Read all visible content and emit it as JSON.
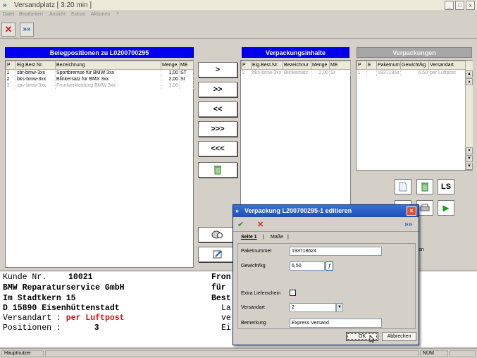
{
  "window": {
    "title": "Versandplatz  [ 3:20 min ]",
    "minimize": "_",
    "maximize": "□",
    "close": "x"
  },
  "menu": [
    "Datei",
    "Bearbeiten",
    "Ansicht",
    "Extras",
    "Aktionen",
    "?"
  ],
  "toolbar": {
    "close_glyph": "✕",
    "forward_glyph": "»»"
  },
  "belegpositionen": {
    "title": "Belegpositionen zu L0200700295",
    "columns": [
      "P",
      "Eig.Best.Nr.",
      "Bezeichnung",
      "Menge",
      "ME"
    ],
    "rows": [
      [
        "1",
        "sbr-bmw-3xx",
        "Sportbremse für BMW 3xx",
        "1,00",
        "ST"
      ],
      [
        "2",
        "bks-bmw-3xx",
        "Blinkersatz für BMX 3xx",
        "2,00",
        "St"
      ],
      [
        "3",
        "zpv-bmw-3xx",
        "Frontverkleidung BMW 3xx",
        "1,00",
        ""
      ]
    ]
  },
  "move_buttons": [
    ">",
    ">>",
    "<<",
    ">>>",
    "<<<"
  ],
  "verpackungsinhalte": {
    "title": "Verpackungsinhalte",
    "columns": [
      "P",
      "Eig.Best.Nr.",
      "Bezeichnur",
      "Menge",
      "ME"
    ],
    "rows": [
      [
        "2",
        "bks-bmw-3xx",
        "Blinkersatz",
        "2,00",
        "St"
      ]
    ]
  },
  "verpackungen": {
    "title": "Verpackungen",
    "columns": [
      "P",
      "E",
      "Paketnum",
      "Gewicht/kg",
      "Versandart"
    ],
    "rows": [
      [
        "1",
        "",
        "1937186z",
        "6,50",
        "per Luftpost"
      ]
    ]
  },
  "action_buttons": {
    "ls_label": "LS",
    "play_glyph": "▶",
    "behind_text": "en"
  },
  "customer": {
    "kunde_label": "Kunde Nr.",
    "kunde_nr": "10021",
    "name": "BMW Reparaturservice GmbH",
    "street": "Im Stadtkern 15",
    "city": "D   15890 Eisenhüttenstadt",
    "versandart_label": "Versandart :",
    "versandart_value": "per Luftpost",
    "positionen_label": "Positionen :",
    "positionen_value": "3",
    "right_lines": [
      "Fron",
      "für",
      "Best"
    ],
    "right_lines2": [
      "La",
      "ve",
      "Ei"
    ]
  },
  "dialog": {
    "title": "Verpackung L200700295-1 editieren",
    "check_glyph": "✔",
    "cancel_glyph": "✕",
    "forward_glyph": "»»",
    "tabs": [
      "Seite 1",
      "Maße"
    ],
    "fields": {
      "paketnummer_label": "Paketnummer",
      "paketnummer_value": "193718624",
      "gewicht_label": "Gewicht/kg",
      "gewicht_value": "6,50",
      "gewicht_button": "ƒ",
      "extra_label": "Extra Lieferschein",
      "versandart_label": "Versandart",
      "versandart_value": "2",
      "bemerkung_label": "Bemerkung",
      "bemerkung_value": "Express Versand"
    },
    "ok_label": "OK",
    "abbrechen_label": "Abbrechen"
  },
  "status": {
    "user": "Hauptnutzer",
    "num": "NUM"
  }
}
